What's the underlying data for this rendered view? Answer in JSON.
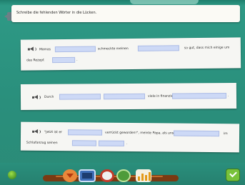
{
  "instruction": {
    "text": "Schreibe die fehlenden Wörter in die Lücken."
  },
  "sentences": [
    {
      "speaker_icon": "speaker-icon",
      "line1": {
        "part1": "Mamas",
        "part2": "schmeckte meinen",
        "part3": "so gut, dass mich einige um"
      },
      "line2": {
        "part1": "das Rezept"
      },
      "gaps": [
        "",
        "",
        ""
      ]
    },
    {
      "speaker_icon": "speaker-icon",
      "line1": {
        "part1": "Durch",
        "part2": "viele in finanzielle"
      },
      "gaps": [
        "",
        "",
        ""
      ]
    },
    {
      "speaker_icon": "speaker-icon",
      "line1": {
        "part1": "\"Jetzt ist er",
        "part2": "verrückt geworden!\", meinte Papa, als unser",
        "part3": "im"
      },
      "line2": {
        "part1": "Schlafanzug seinen"
      },
      "gaps": [
        "",
        "",
        "",
        ""
      ]
    }
  ],
  "toolbar": {
    "icons": [
      "back-icon",
      "keyboard-icon",
      "help-icon",
      "home-icon",
      "stats-icon"
    ],
    "confirm_icon": "checkmark-icon"
  },
  "colors": {
    "background": "#2e9a86",
    "gap_fill": "#cdd9f6",
    "card": "#f6f6f3",
    "confirm": "#78c23a"
  }
}
